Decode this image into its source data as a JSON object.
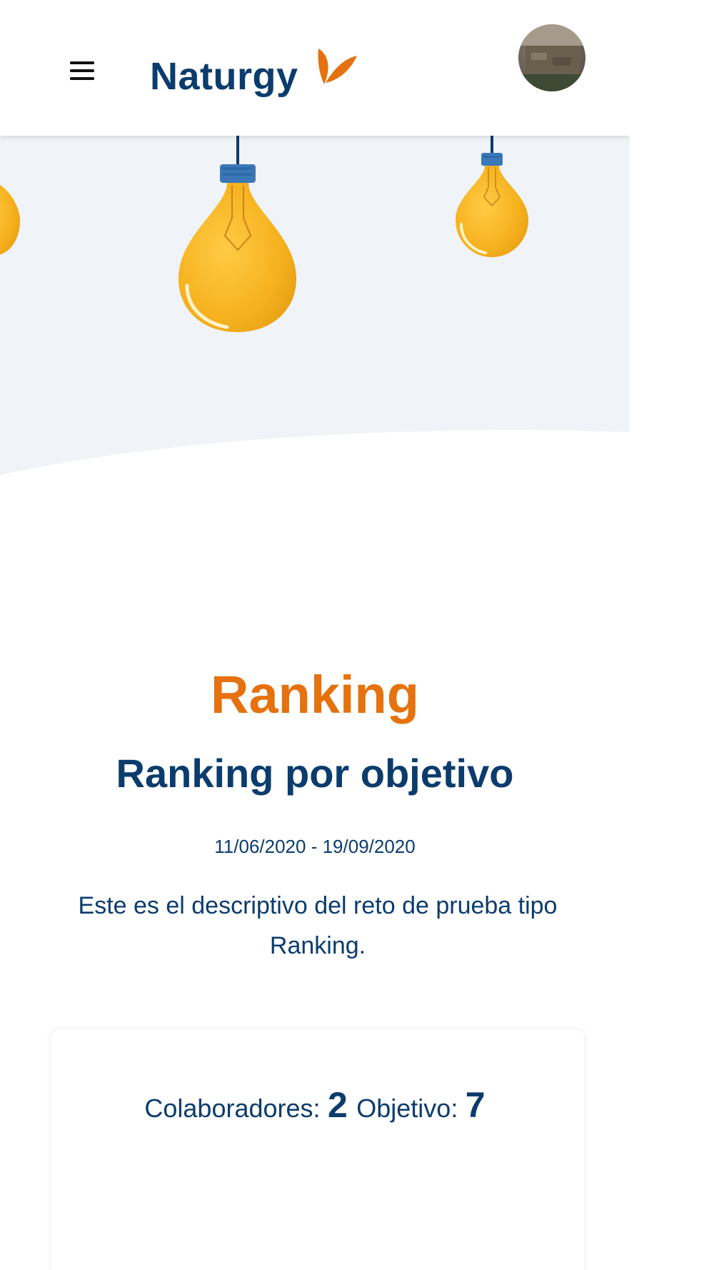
{
  "header": {
    "menu_icon": "hamburger-menu-icon",
    "logo_text": "Naturgy",
    "logo_mark_icon": "naturgy-butterfly-icon",
    "avatar_icon": "user-avatar"
  },
  "hero": {
    "illustration": "hanging-light-bulbs"
  },
  "challenge": {
    "title": "Ranking",
    "subtitle": "Ranking por objetivo",
    "dates": "11/06/2020 - 19/09/2020",
    "description": "Este es el descriptivo del reto de prueba tipo Ranking."
  },
  "stats": {
    "collaborators_label": "Colaboradores:",
    "collaborators_value": "2",
    "objective_label": "Objetivo:",
    "objective_value": "7"
  },
  "colors": {
    "brand_blue": "#0b3c6d",
    "brand_orange": "#e5720e",
    "hero_bg": "#f0f3f7",
    "bulb_yellow": "#f6b21f"
  }
}
